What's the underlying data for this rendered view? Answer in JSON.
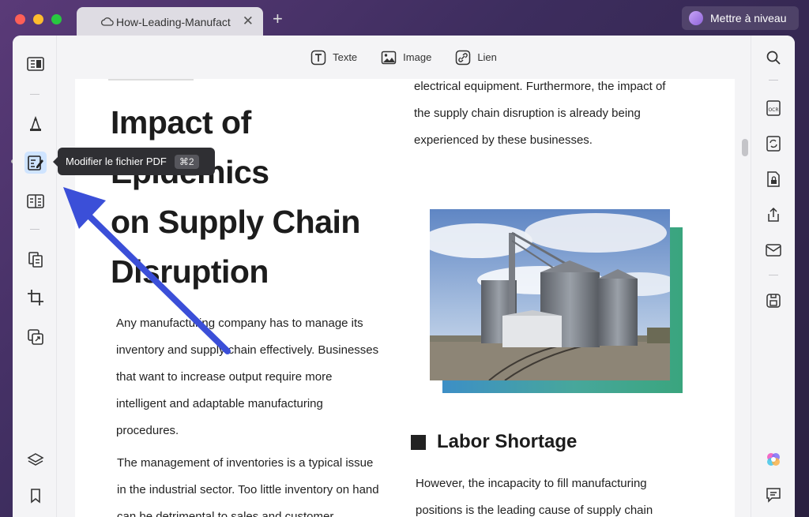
{
  "window": {
    "tab_title": "How-Leading-Manufact",
    "new_tab_label": "+",
    "close_tab_label": "✕",
    "upgrade_label": "Mettre à niveau"
  },
  "toolbar": {
    "text_label": "Texte",
    "image_label": "Image",
    "link_label": "Lien"
  },
  "tooltip": {
    "label": "Modifier le fichier PDF",
    "shortcut": "⌘2"
  },
  "left_sidebar": {
    "icons": [
      "reader-icon",
      "comment-icon",
      "edit-pdf-icon",
      "form-icon",
      "organize-pages-icon",
      "crop-icon",
      "convert-icon",
      "layers-icon",
      "bookmark-icon"
    ]
  },
  "right_sidebar": {
    "icons": [
      "search-icon",
      "ocr-icon",
      "convert-icon",
      "protect-icon",
      "share-icon",
      "email-icon",
      "save-icon",
      "ai-assistant-icon",
      "comment-list-icon"
    ]
  },
  "document": {
    "heading_lines": [
      "Impact of",
      "Epidemics",
      "on Supply Chain",
      "Disruption"
    ],
    "left_para1": [
      "Any manufacturing company has to manage its",
      "inventory and supply chain effectively. Businesses",
      "that want to increase output require more",
      "intelligent and adaptable manufacturing",
      "procedures."
    ],
    "left_para2": [
      "The management of inventories is a typical issue",
      "in the industrial sector. Too little inventory on hand",
      "can be detrimental to sales and customer"
    ],
    "right_para1": [
      "electrical equipment. Furthermore, the impact of",
      "the supply chain disruption is already being",
      "experienced by these businesses."
    ],
    "section_title": "Labor Shortage",
    "right_para2": [
      "However, the incapacity to fill manufacturing",
      "positions is the leading cause of supply chain"
    ]
  },
  "colors": {
    "accent_arrow": "#3b4fd8",
    "active_tab_bg": "#cfe4ff"
  }
}
